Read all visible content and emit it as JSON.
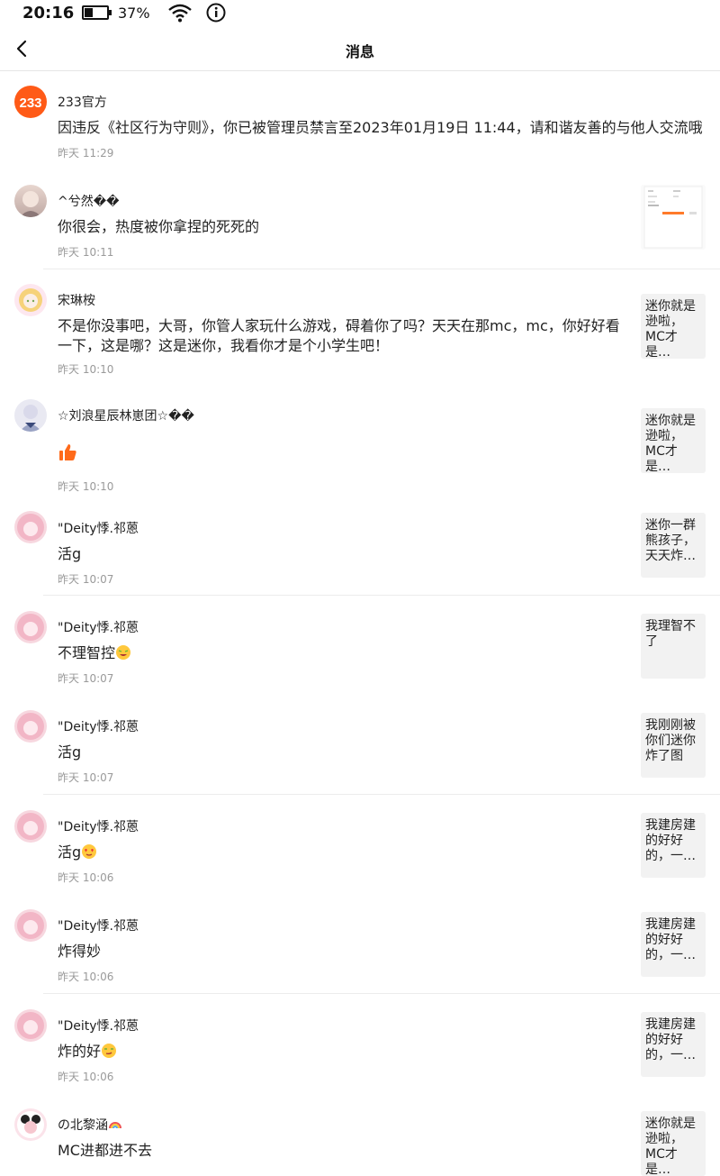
{
  "status_bar": {
    "time": "20:16",
    "battery_percent": "37%",
    "battery_level": 0.37
  },
  "header": {
    "title": "消息"
  },
  "messages": [
    {
      "name": "233官方",
      "text": "因违反《社区行为守则》，你已被管理员禁言至2023年01月19日 11:44，请和谐友善的与他人交流哦",
      "time": "昨天 11:29",
      "preview": ""
    },
    {
      "name": "^兮然��",
      "text": "你很会，热度被你拿捏的死死的",
      "time": "昨天 10:11",
      "preview": ""
    },
    {
      "name": "宋琳桉",
      "text": "不是你没事吧，大哥，你管人家玩什么游戏，碍着你了吗？天天在那mc，mc，你好好看一下，这是哪？这是迷你，我看你才是个小学生吧！",
      "time": "昨天 10:10",
      "preview": "迷你就是逊啦，MC才是…"
    },
    {
      "name": "☆刘浪星辰林崽团☆��",
      "text": "",
      "time": "昨天 10:10",
      "preview": "迷你就是逊啦，MC才是…"
    },
    {
      "name": "\"Deity悸.祁蒽",
      "text": "活g",
      "time": "昨天 10:07",
      "preview": "迷你一群熊孩子，天天炸…"
    },
    {
      "name": "\"Deity悸.祁蒽",
      "text": "不理智控",
      "time": "昨天 10:07",
      "preview": "我理智不了"
    },
    {
      "name": "\"Deity悸.祁蒽",
      "text": "活g",
      "time": "昨天 10:07",
      "preview": "我刚刚被你们迷你炸了图"
    },
    {
      "name": "\"Deity悸.祁蒽",
      "text": "活g",
      "time": "昨天 10:06",
      "preview": "我建房建的好好的，一…"
    },
    {
      "name": "\"Deity悸.祁蒽",
      "text": "炸得妙",
      "time": "昨天 10:06",
      "preview": "我建房建的好好的，一…"
    },
    {
      "name": "\"Deity悸.祁蒽",
      "text": "炸的好",
      "time": "昨天 10:06",
      "preview": "我建房建的好好的，一…"
    },
    {
      "name": "の北黎涵",
      "text": "MC进都进不去",
      "time": "",
      "preview": "迷你就是逊啦，MC才是…"
    }
  ],
  "icons": {
    "back": "back-arrow-icon",
    "like": "thumbs-up-icon",
    "wifi": "wifi-icon",
    "info": "info-icon",
    "battery": "battery-icon"
  },
  "colors": {
    "accent": "#FF6A1A",
    "time_text": "#9A9A9A",
    "preview_bg": "#F2F2F2"
  }
}
